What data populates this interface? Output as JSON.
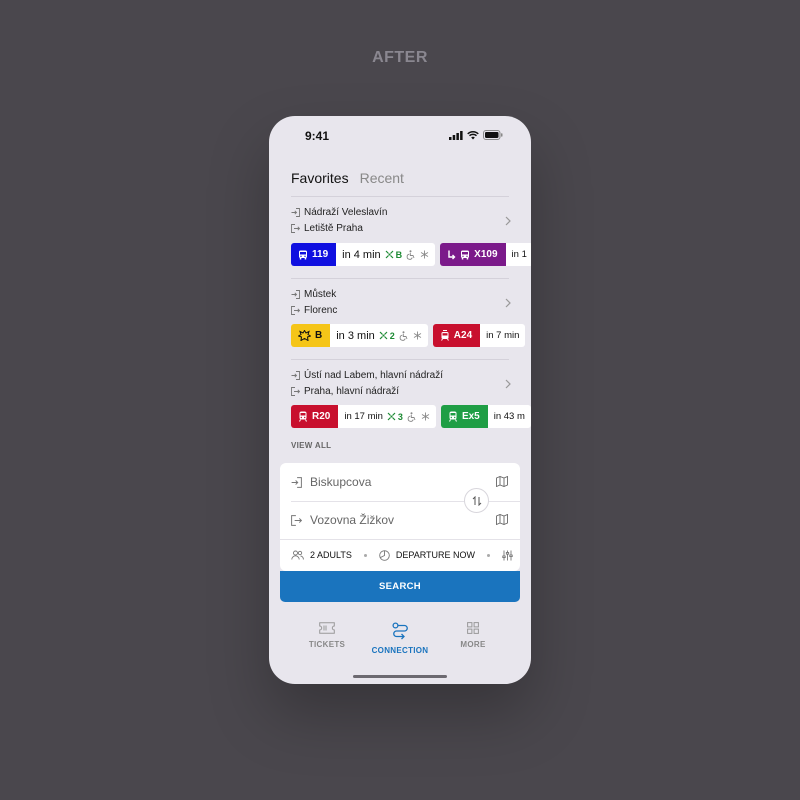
{
  "page_label": "AFTER",
  "status_bar": {
    "time": "9:41"
  },
  "tabs": {
    "favorites": "Favorites",
    "recent": "Recent"
  },
  "favorites": [
    {
      "from": "Nádraží Veleslavín",
      "to": "Letiště Praha",
      "departures": [
        {
          "line": "119",
          "mode": "bus",
          "color": "#1010e0",
          "eta": "in 4 min",
          "crowd": "B",
          "wheelchair": true,
          "ac": true
        },
        {
          "line": "X109",
          "mode": "bus-replacement",
          "color": "#7b1a8a",
          "eta": "in 1"
        }
      ]
    },
    {
      "from": "Můstek",
      "to": "Florenc",
      "departures": [
        {
          "line": "B",
          "mode": "metro",
          "color": "#f5c518",
          "eta": "in 3 min",
          "crowd": "2",
          "wheelchair": true,
          "ac": true
        },
        {
          "line": "A24",
          "mode": "tram",
          "color": "#c8102e",
          "eta": "in 7 min"
        }
      ]
    },
    {
      "from": "Ústí nad Labem, hlavní nádraží",
      "to": "Praha, hlavní nádraží",
      "departures": [
        {
          "line": "R20",
          "mode": "train",
          "color": "#c8102e",
          "eta": "in 17 min",
          "crowd": "3",
          "wheelchair": true,
          "ac": true
        },
        {
          "line": "Ex5",
          "mode": "train",
          "color": "#1f9e45",
          "eta": "in 43 m"
        }
      ]
    }
  ],
  "view_all": "VIEW ALL",
  "search_form": {
    "from_value": "Biskupcova",
    "to_value": "Vozovna Žižkov",
    "passengers": "2 ADULTS",
    "time_option": "DEPARTURE NOW",
    "search_label": "SEARCH"
  },
  "nav": {
    "tickets": "TICKETS",
    "connection": "CONNECTION",
    "more": "MORE"
  },
  "colors": {
    "accent": "#1a74be",
    "background": "#4a474d",
    "phone_bg": "#e8e6ed"
  }
}
